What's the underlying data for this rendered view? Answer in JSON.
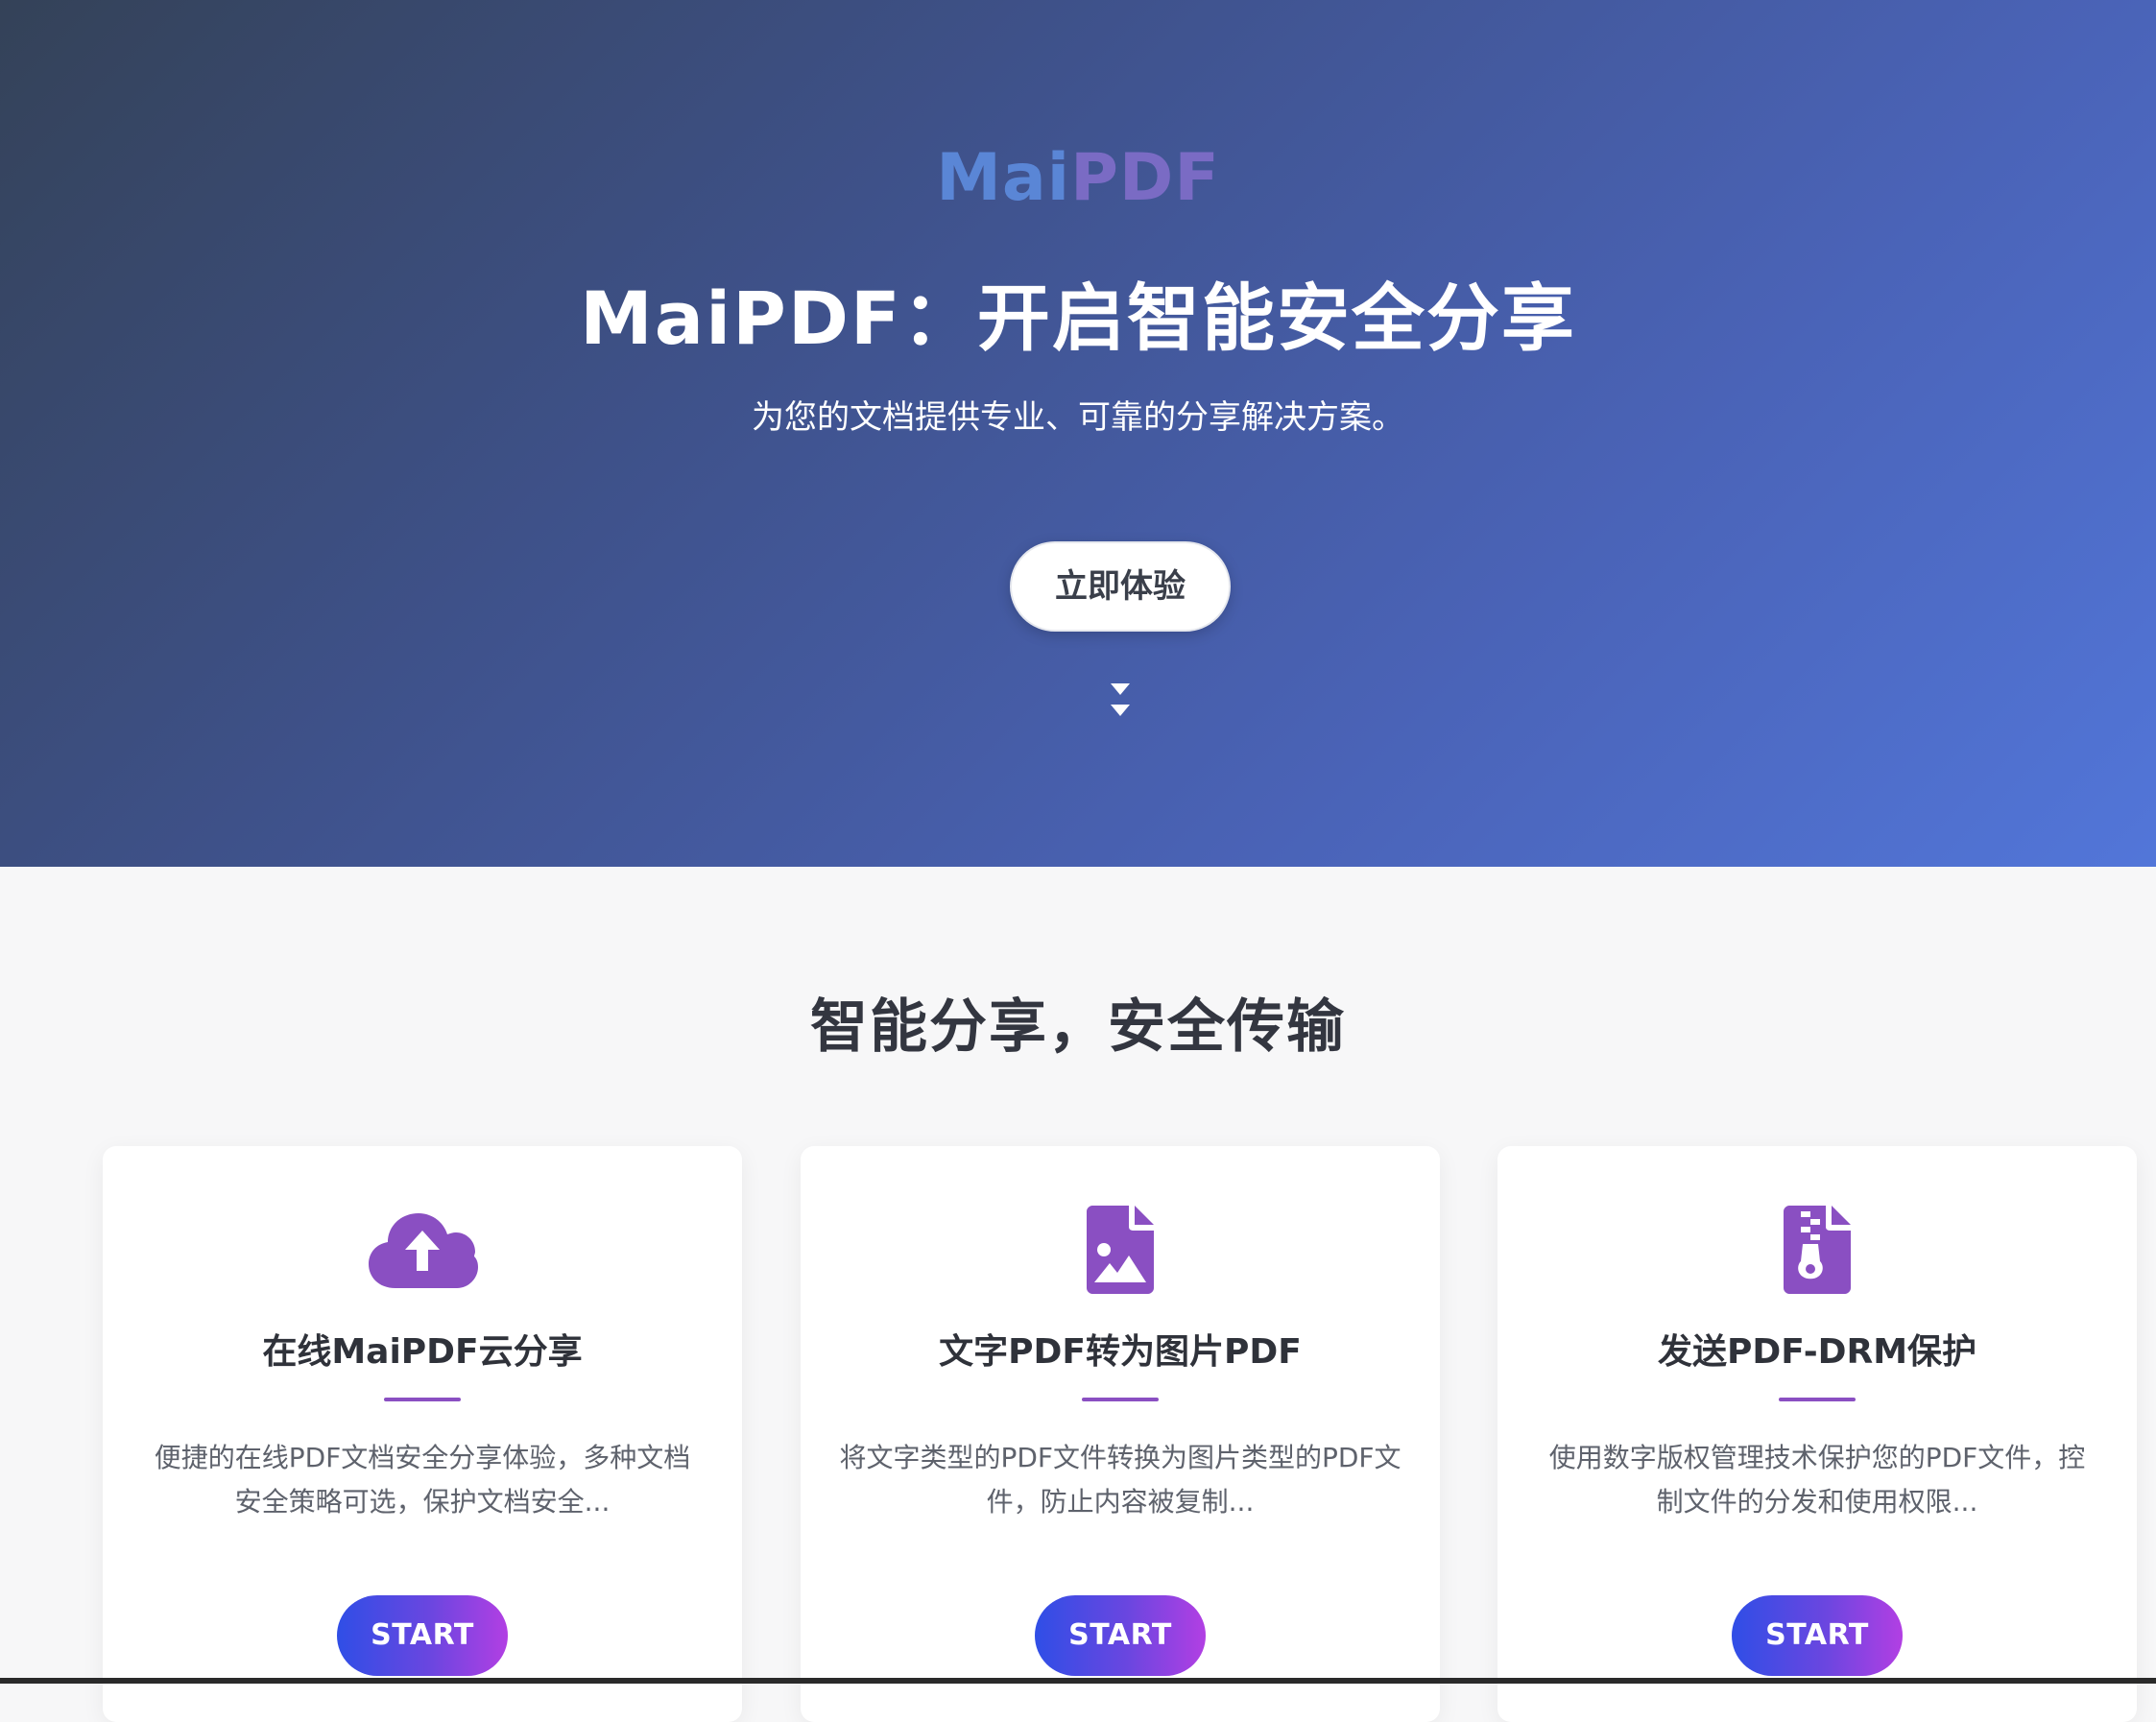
{
  "hero": {
    "brand_part1": "Mai",
    "brand_part2": "PDF",
    "title": "MaiPDF：开启智能安全分享",
    "subtitle": "为您的文档提供专业、可靠的分享解决方案。",
    "cta_label": "立即体验",
    "scroll_icon": "double-chevron-down-icon"
  },
  "features": {
    "heading": "智能分享，安全传输",
    "cards": [
      {
        "icon": "cloud-upload-icon",
        "title": "在线MaiPDF云分享",
        "description": "便捷的在线PDF文档安全分享体验，多种文档安全策略可选，保护文档安全...",
        "button_label": "START"
      },
      {
        "icon": "file-image-icon",
        "title": "文字PDF转为图片PDF",
        "description": "将文字类型的PDF文件转换为图片类型的PDF文件，防止内容被复制...",
        "button_label": "START"
      },
      {
        "icon": "file-zipper-icon",
        "title": "发送PDF-DRM保护",
        "description": "使用数字版权管理技术保护您的PDF文件，控制文件的分发和使用权限...",
        "button_label": "START"
      }
    ]
  },
  "colors": {
    "accent_purple": "#8a4fc2",
    "hero_gradient_start": "#344258",
    "hero_gradient_end": "#5276d9",
    "button_gradient_start": "#2f4ee6",
    "button_gradient_end": "#b23fe3"
  }
}
